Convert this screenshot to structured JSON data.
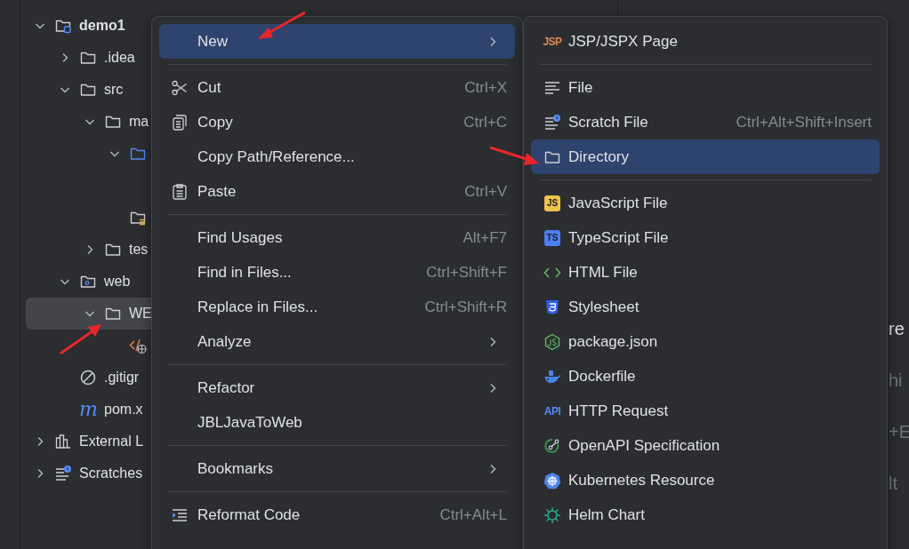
{
  "project_tree": [
    {
      "label": "demo1",
      "kind": "module",
      "expanded": true,
      "selected": false,
      "children": [
        {
          "label": ".idea",
          "kind": "folder",
          "expanded": false,
          "selected": false
        },
        {
          "label": "src",
          "kind": "folder",
          "expanded": true,
          "selected": false,
          "children": [
            {
              "label": "ma",
              "kind": "folder",
              "expanded": true,
              "selected": false,
              "children": [
                {
                  "kind": "folder-source",
                  "expanded": true,
                  "selected": false
                },
                {
                  "kind": "folder-resources",
                  "selected": false
                }
              ]
            },
            {
              "label": "tes",
              "kind": "folder",
              "expanded": false,
              "selected": false
            }
          ]
        },
        {
          "label": "web",
          "kind": "folder-web",
          "expanded": true,
          "selected": false,
          "children": [
            {
              "label": "WE",
              "kind": "folder",
              "expanded": true,
              "selected": true,
              "children": [
                {
                  "kind": "jsp-file",
                  "selected": false
                }
              ]
            }
          ]
        },
        {
          "label": ".gitigr",
          "kind": "gitignore",
          "selected": false
        },
        {
          "label": "pom.x",
          "kind": "maven",
          "icon_text": "m",
          "selected": false
        }
      ]
    },
    {
      "label": "External L",
      "kind": "libraries",
      "expanded": false,
      "selected": false
    },
    {
      "label": "Scratches",
      "kind": "scratches",
      "expanded": false,
      "selected": false
    }
  ],
  "editor_fragments": [
    {
      "text": "re",
      "muted": false
    },
    {
      "text": "hi",
      "muted": true
    },
    {
      "text": "+E",
      "muted": true
    },
    {
      "text": "lt",
      "muted": true
    }
  ],
  "context_menu": [
    {
      "kind": "item",
      "label": "New",
      "submenu": true,
      "selected": true
    },
    {
      "kind": "separator"
    },
    {
      "kind": "item",
      "label": "Cut",
      "shortcut": "Ctrl+X",
      "submenu": false,
      "selected": false
    },
    {
      "kind": "item",
      "label": "Copy",
      "shortcut": "Ctrl+C",
      "submenu": false,
      "selected": false
    },
    {
      "kind": "item",
      "label": "Copy Path/Reference...",
      "submenu": false,
      "selected": false
    },
    {
      "kind": "item",
      "label": "Paste",
      "shortcut": "Ctrl+V",
      "submenu": false,
      "selected": false
    },
    {
      "kind": "separator"
    },
    {
      "kind": "item",
      "label": "Find Usages",
      "shortcut": "Alt+F7",
      "submenu": false,
      "selected": false
    },
    {
      "kind": "item",
      "label": "Find in Files...",
      "shortcut": "Ctrl+Shift+F",
      "submenu": false,
      "selected": false
    },
    {
      "kind": "item",
      "label": "Replace in Files...",
      "shortcut": "Ctrl+Shift+R",
      "submenu": false,
      "selected": false
    },
    {
      "kind": "item",
      "label": "Analyze",
      "submenu": true,
      "selected": false
    },
    {
      "kind": "separator"
    },
    {
      "kind": "item",
      "label": "Refactor",
      "submenu": true,
      "selected": false
    },
    {
      "kind": "item",
      "label": "JBLJavaToWeb",
      "submenu": false,
      "selected": false
    },
    {
      "kind": "separator"
    },
    {
      "kind": "item",
      "label": "Bookmarks",
      "submenu": true,
      "selected": false
    },
    {
      "kind": "separator"
    },
    {
      "kind": "item",
      "label": "Reformat Code",
      "shortcut": "Ctrl+Alt+L",
      "submenu": false,
      "selected": false
    }
  ],
  "new_submenu": [
    {
      "kind": "item",
      "label": "JSP/JSPX Page",
      "icon_text": "JSP",
      "color": "#e08855",
      "selected": false
    },
    {
      "kind": "separator"
    },
    {
      "kind": "item",
      "label": "File",
      "selected": false
    },
    {
      "kind": "item",
      "label": "Scratch File",
      "shortcut": "Ctrl+Alt+Shift+Insert",
      "selected": false
    },
    {
      "kind": "item",
      "label": "Directory",
      "selected": true
    },
    {
      "kind": "separator"
    },
    {
      "kind": "item",
      "label": "JavaScript File",
      "icon_text": "JS",
      "color": "#f0c14b",
      "selected": false
    },
    {
      "kind": "item",
      "label": "TypeScript File",
      "icon_text": "TS",
      "color": "#4b7ef0",
      "selected": false
    },
    {
      "kind": "item",
      "label": "HTML File",
      "selected": false
    },
    {
      "kind": "item",
      "label": "Stylesheet",
      "selected": false
    },
    {
      "kind": "item",
      "label": "package.json",
      "selected": false
    },
    {
      "kind": "item",
      "label": "Dockerfile",
      "selected": false
    },
    {
      "kind": "item",
      "label": "HTTP Request",
      "icon_text": "API",
      "color": "#548af7",
      "selected": false
    },
    {
      "kind": "item",
      "label": "OpenAPI Specification",
      "selected": false
    },
    {
      "kind": "item",
      "label": "Kubernetes Resource",
      "selected": false
    },
    {
      "kind": "item",
      "label": "Helm Chart",
      "selected": false
    }
  ]
}
